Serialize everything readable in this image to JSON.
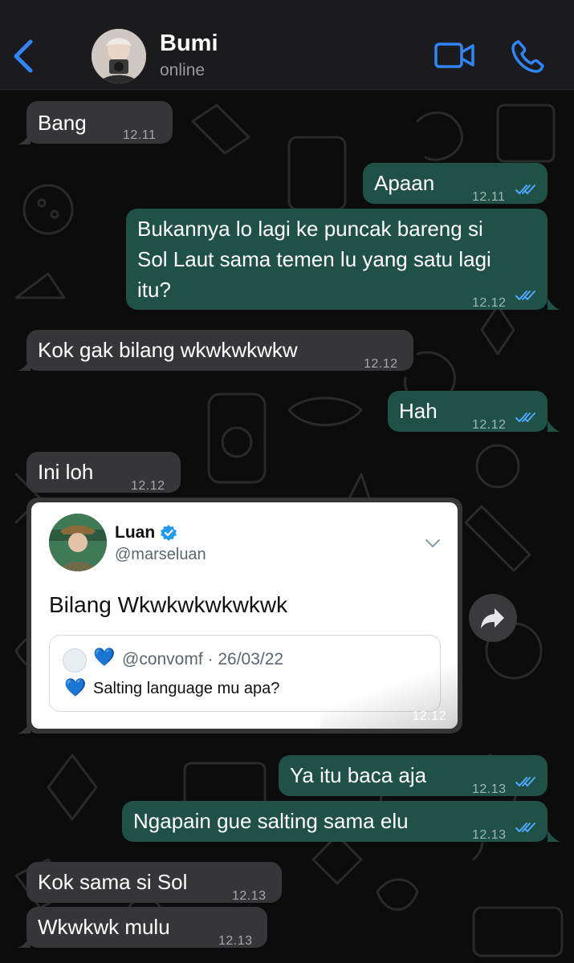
{
  "header": {
    "contact_name": "Bumi",
    "contact_status": "online"
  },
  "colors": {
    "incoming_bubble": "#363638",
    "outgoing_bubble": "#1f5147",
    "accent": "#2f86f6",
    "read_ticks": "#4fa8ff",
    "verified_badge": "#1d9bf0"
  },
  "messages": [
    {
      "text": "Bang",
      "time": "12.11",
      "direction": "in"
    },
    {
      "text": "Apaan",
      "time": "12.11",
      "direction": "out",
      "read": true
    },
    {
      "lines": [
        "Bukannya lo lagi ke puncak bareng si",
        "Sol Laut sama temen lu yang satu lagi",
        "itu?"
      ],
      "time": "12.12",
      "direction": "out",
      "read": true
    },
    {
      "text": "Kok gak bilang wkwkwkwkw",
      "time": "12.12",
      "direction": "in"
    },
    {
      "text": "Hah",
      "time": "12.12",
      "direction": "out",
      "read": true
    },
    {
      "text": "Ini loh",
      "time": "12.12",
      "direction": "in"
    },
    {
      "text": "Ya itu baca aja",
      "time": "12.13",
      "direction": "out",
      "read": true
    },
    {
      "text": "Ngapain gue salting sama elu",
      "time": "12.13",
      "direction": "out",
      "read": true
    },
    {
      "text": "Kok sama si Sol",
      "time": "12.13",
      "direction": "in"
    },
    {
      "text": "Wkwkwk mulu",
      "time": "12.13",
      "direction": "in"
    }
  ],
  "tweet": {
    "name": "Luan",
    "handle": "@marseluan",
    "text": "Bilang Wkwkwkwkwkwk",
    "quote": {
      "handle": "@convomf",
      "date": "26/03/22",
      "heart": "💙",
      "text": "Salting language mu apa?"
    },
    "time": "12.12"
  },
  "icons": {
    "back": "chevron-left-icon",
    "video": "video-camera-icon",
    "call": "phone-icon",
    "share": "forward-arrow-icon"
  }
}
